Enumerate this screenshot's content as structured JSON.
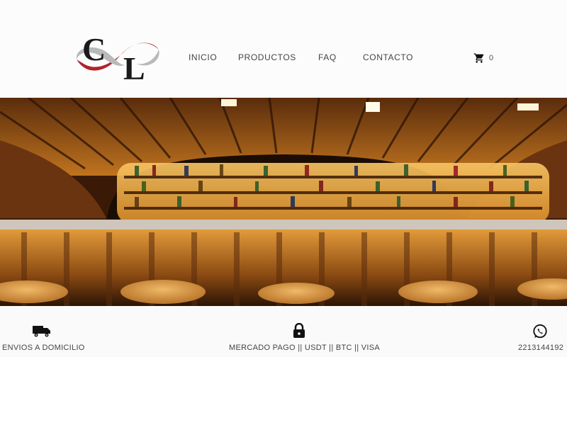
{
  "brand": {
    "logo_text": "CL",
    "logo_c": "C",
    "logo_l": "L",
    "colors": {
      "red": "#b5212b",
      "gray": "#b9b9b9",
      "dark": "#1a1a1a"
    }
  },
  "nav": {
    "items": [
      {
        "label": "INICIO"
      },
      {
        "label": "PRODUCTOS"
      },
      {
        "label": "FAQ"
      },
      {
        "label": "CONTACTO"
      }
    ]
  },
  "cart": {
    "icon": "cart-icon",
    "count": "0"
  },
  "hero": {
    "image": "bar-interior",
    "colors": {
      "wood": "#c77a22",
      "glow": "#f5b850"
    }
  },
  "features": [
    {
      "icon": "truck-icon",
      "text": "ENVIOS A DOMICILIO"
    },
    {
      "icon": "lock-icon",
      "text": "MERCADO PAGO || USDT || BTC || VISA"
    },
    {
      "icon": "whatsapp-icon",
      "text": "2213144192"
    }
  ]
}
